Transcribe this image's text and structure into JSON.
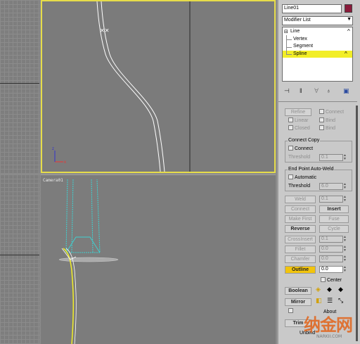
{
  "viewports": {
    "perspective_label": "Camera01"
  },
  "panel": {
    "object_name": "Line01",
    "object_color": "#8a1a3a",
    "modifier_list_label": "Modifier List",
    "stack": {
      "root": "Line",
      "items": [
        "Vertex",
        "Segment",
        "Spline"
      ],
      "selected": "Spline"
    },
    "toolbar_icons": [
      "pin-stack-icon",
      "show-end-result-icon",
      "make-unique-icon",
      "remove-modifier-icon",
      "configure-sets-icon"
    ],
    "geometry": {
      "refine_label": "Refine",
      "connect_label": "Connect",
      "linear_label": "Linear",
      "bind_first_label": "Bind",
      "closed_label": "Closed",
      "bind_last_label": "Bind",
      "connect_copy": {
        "title": "Connect Copy",
        "connect_label": "Connect",
        "threshold_label": "Threshold",
        "threshold_value": "0.1"
      },
      "endpoint_weld": {
        "title": "End Point Auto-Weld",
        "automatic_label": "Automatic",
        "threshold_label": "Threshold",
        "threshold_value": "6.0"
      },
      "weld_label": "Weld",
      "weld_value": "0.1",
      "connect_btn": "Connect",
      "insert_btn": "Insert",
      "make_first_btn": "Make First",
      "fuse_btn": "Fuse",
      "reverse_btn": "Reverse",
      "cycle_btn": "Cycle",
      "crossinsert_btn": "CrossInsert",
      "crossinsert_value": "0.1",
      "fillet_btn": "Fillet",
      "fillet_value": "0.0",
      "chamfer_btn": "Chamfer",
      "chamfer_value": "0.0",
      "outline_btn": "Outline",
      "outline_value": "0.0",
      "center_label": "Center",
      "boolean_btn": "Boolean",
      "mirror_btn": "Mirror",
      "trim_btn": "Trim",
      "about_label": "About",
      "unbind_label": "Unbind"
    }
  },
  "watermark": {
    "main": "纳金网",
    "sub": "NARKII.COM"
  }
}
